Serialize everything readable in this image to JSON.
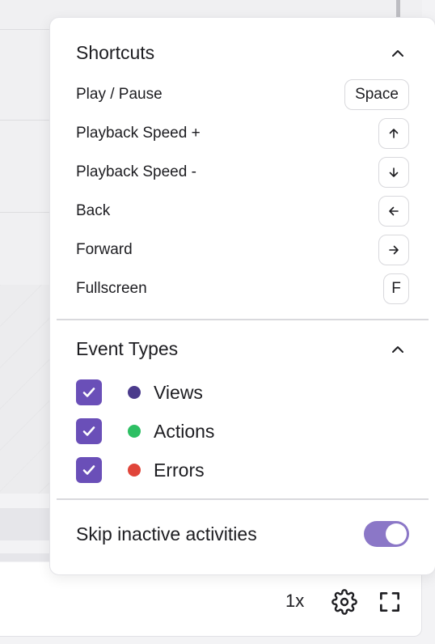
{
  "player": {
    "speed_label": "1x",
    "settings_icon": "gear-icon",
    "fullscreen_icon": "fullscreen-icon"
  },
  "shortcuts": {
    "title": "Shortcuts",
    "collapse_icon": "chevron-up-icon",
    "items": [
      {
        "label": "Play / Pause",
        "key": "Space"
      },
      {
        "label": "Playback Speed +",
        "key_icon": "arrow-up-icon"
      },
      {
        "label": "Playback Speed -",
        "key_icon": "arrow-down-icon"
      },
      {
        "label": "Back",
        "key_icon": "arrow-left-icon"
      },
      {
        "label": "Forward",
        "key_icon": "arrow-right-icon"
      },
      {
        "label": "Fullscreen",
        "key": "F"
      }
    ]
  },
  "event_types": {
    "title": "Event Types",
    "collapse_icon": "chevron-up-icon",
    "items": [
      {
        "label": "Views",
        "checked": true,
        "color": "#4b3b8c"
      },
      {
        "label": "Actions",
        "checked": true,
        "color": "#2dbf63"
      },
      {
        "label": "Errors",
        "checked": true,
        "color": "#e0453a"
      }
    ]
  },
  "skip_inactive": {
    "label": "Skip inactive activities",
    "enabled": true
  },
  "colors": {
    "accent": "#6a4fb8",
    "toggle_on": "#8b77c7"
  }
}
